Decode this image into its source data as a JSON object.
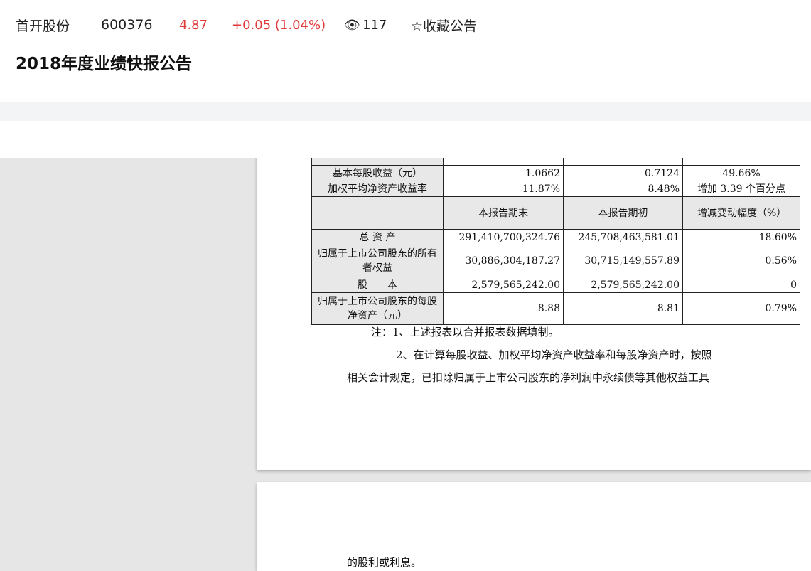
{
  "header": {
    "stock_name": "首开股份",
    "stock_code": "600376",
    "price": "4.87",
    "change": "+0.05 (1.04%)",
    "views_icon": "eye-icon",
    "views": "117",
    "favorite_label": "☆收藏公告",
    "title": "2018年度业绩快报公告"
  },
  "table": {
    "rows1": [
      {
        "label": "基本每股收益（元）",
        "current": "1.0662",
        "previous": "0.7124",
        "change": "49.66%"
      },
      {
        "label": "加权平均净资产收益率",
        "current": "11.87%",
        "previous": "8.48%",
        "change": "增加 3.39 个百分点"
      }
    ],
    "header2": {
      "col1": "本报告期末",
      "col2": "本报告期初",
      "col3": "增减变动幅度（%）"
    },
    "rows2": [
      {
        "label": "总 资 产",
        "current": "291,410,700,324.76",
        "previous": "245,708,463,581.01",
        "change": "18.60%"
      },
      {
        "label": "归属于上市公司股东的所有者权益",
        "current": "30,886,304,187.27",
        "previous": "30,715,149,557.89",
        "change": "0.56%"
      },
      {
        "label": "股　　本",
        "current": "2,579,565,242.00",
        "previous": "2,579,565,242.00",
        "change": "0"
      },
      {
        "label": "归属于上市公司股东的每股净资产（元）",
        "current": "8.88",
        "previous": "8.81",
        "change": "0.79%"
      }
    ]
  },
  "notes": [
    "注：1、上述报表以合并报表数据填制。",
    "2、在计算每股收益、加权平均净资产收益率和每股净资产时，按照",
    "相关会计规定，已扣除归属于上市公司股东的净利润中永续债等其他权益工具",
    "的股利或利息。"
  ]
}
